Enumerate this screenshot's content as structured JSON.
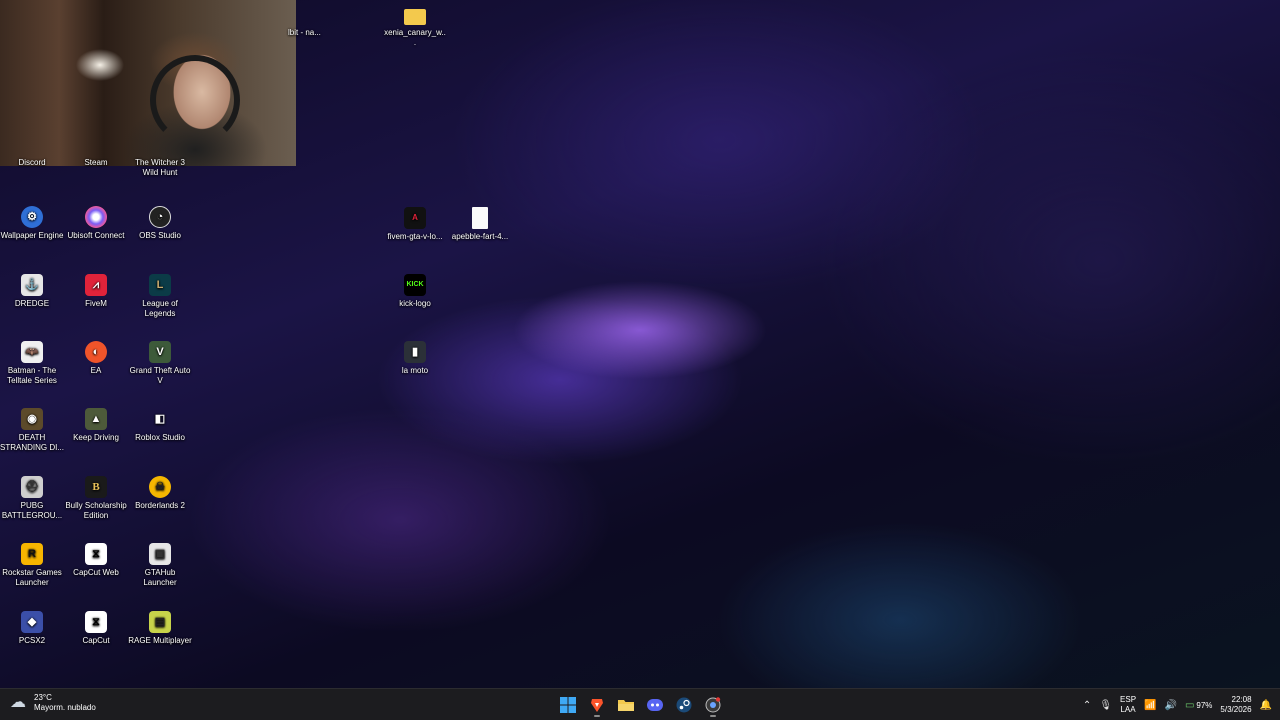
{
  "desktop_icons": {
    "discord": "Discord",
    "steam": "Steam",
    "witcher": "The Witcher 3 Wild Hunt",
    "wallpaper_engine": "Wallpaper Engine",
    "ubisoft": "Ubisoft Connect",
    "obs": "OBS Studio",
    "dredge": "DREDGE",
    "fivem": "FiveM",
    "lol": "League of Legends",
    "batman": "Batman - The Telltale Series",
    "ea": "EA",
    "gta5": "Grand Theft Auto V",
    "death_stranding": "DEATH STRANDING DI...",
    "keep_driving": "Keep Driving",
    "roblox_studio": "Roblox Studio",
    "pubg": "PUBG BATTLEGROU...",
    "bully": "Bully Scholarship Edition",
    "borderlands": "Borderlands 2",
    "rockstar": "Rockstar Games Launcher",
    "capcut_web": "CapCut Web",
    "gtahub": "GTAHub Launcher",
    "pcsx2": "PCSX2",
    "capcut": "CapCut",
    "rage": "RAGE Multiplayer",
    "partial": "lbit - na...",
    "xenia": "xenia_canary_w...",
    "fivem_gta": "fivem-gta-v-lo...",
    "apebble": "apebble-fart-4...",
    "kick": "kick-logo",
    "la_moto": "la moto"
  },
  "icon_glyphs": {
    "kick": "KICK",
    "bully": "B",
    "rockstar": "R"
  },
  "taskbar": {
    "weather_temp": "23°C",
    "weather_desc": "Mayorm. nublado",
    "lang_top": "ESP",
    "lang_bottom": "LAA",
    "battery": "97%",
    "time": "22:08",
    "date": "5/3/2026",
    "pinned": [
      "windows-start-icon",
      "brave-icon",
      "file-explorer-icon",
      "discord-icon",
      "steam-icon",
      "chrome-icon"
    ]
  },
  "colors": {
    "accent_blue": "#3fa9f5",
    "taskbar_bg": "#1c1c1f",
    "kick_green": "#53fc18"
  }
}
